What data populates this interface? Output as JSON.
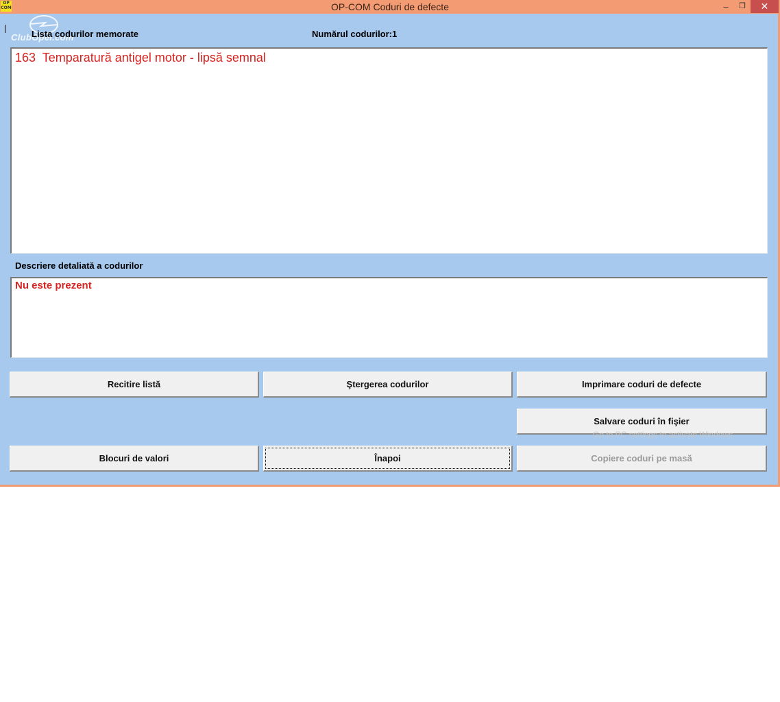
{
  "window": {
    "icon_text": "OP\nCOM",
    "title": "OP-COM    Coduri de defecte",
    "min_glyph": "–",
    "max_glyph": "❐",
    "close_glyph": "✕"
  },
  "logo": {
    "text": "ClubOpel.com"
  },
  "labels": {
    "list": "Lista codurilor memorate",
    "count": "Numărul codurilor:1",
    "description": "Descriere detaliată a codurilor"
  },
  "codes": [
    {
      "code": "163",
      "text": "Temparatură antigel motor - lipsă semnal"
    }
  ],
  "description_text": "Nu este prezent",
  "buttons": {
    "recitire": "Recitire listă",
    "stergere": "Ştergerea codurilor",
    "imprimare": "Imprimare coduri de defecte",
    "salvare": "Salvare coduri în fişier",
    "blocuri": "Blocuri de valori",
    "inapoi": "Înapoi",
    "copiere": "Copiere coduri pe masă"
  },
  "watermark": "Go to PC settings to activate Windows.",
  "colors": {
    "title_bar": "#f39b73",
    "client_bg": "#a7c9ee",
    "code_red": "#d42320",
    "close_button": "#c7504f"
  }
}
